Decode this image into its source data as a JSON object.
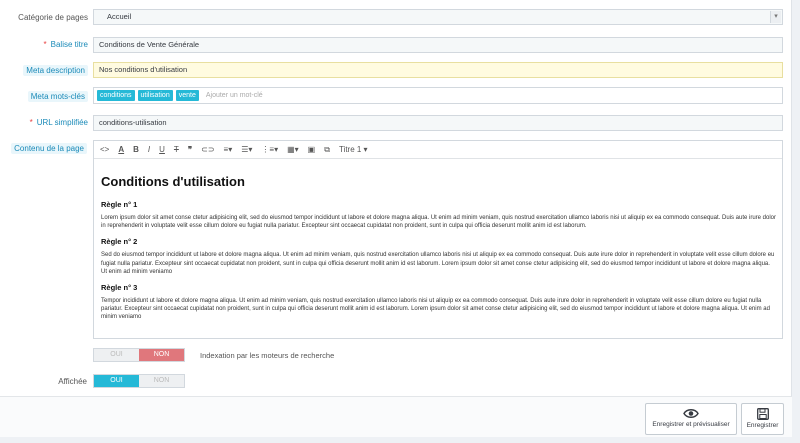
{
  "form": {
    "category": {
      "label": "Catégorie de pages",
      "value": "Accueil"
    },
    "meta_title": {
      "label": "Balise titre",
      "value": "Conditions de Vente Générale"
    },
    "meta_description": {
      "label": "Meta description",
      "value": "Nos conditions d'utilisation"
    },
    "meta_keywords": {
      "label": "Meta mots-clés",
      "tags": [
        "conditions",
        "utilisation",
        "vente"
      ],
      "placeholder": "Ajouter un mot-clé"
    },
    "friendly_url": {
      "label": "URL simplifiée",
      "value": "conditions-utilisation"
    },
    "content": {
      "label": "Contenu de la page"
    }
  },
  "editor": {
    "format_label": "Titre 1",
    "heading": "Conditions d'utilisation",
    "rules": [
      {
        "title": "Règle n° 1",
        "text": "Lorem ipsum dolor sit amet conse ctetur adipisicing elit, sed do eiusmod tempor incididunt ut labore et dolore magna aliqua. Ut enim ad minim veniam, quis nostrud exercitation ullamco laboris nisi ut aliquip ex ea commodo consequat. Duis aute irure dolor in reprehenderit in voluptate velit esse cillum dolore eu fugiat nulla pariatur. Excepteur sint occaecat cupidatat non proident, sunt in culpa qui officia deserunt mollit anim id est laborum."
      },
      {
        "title": "Règle n° 2",
        "text": "Sed do eiusmod tempor incididunt ut labore et dolore magna aliqua. Ut enim ad minim veniam, quis nostrud exercitation ullamco laboris nisi ut aliquip ex ea commodo consequat. Duis aute irure dolor in reprehenderit in voluptate velit esse cillum dolore eu fugiat nulla pariatur. Excepteur sint occaecat cupidatat non proident, sunt in culpa qui officia deserunt mollit anim id est laborum. Lorem ipsum dolor sit amet conse ctetur adipisicing elit, sed do eiusmod tempor incididunt ut labore et dolore magna aliqua. Ut enim ad minim veniamo"
      },
      {
        "title": "Règle n° 3",
        "text": "Tempor incididunt ut labore et dolore magna aliqua. Ut enim ad minim veniam, quis nostrud exercitation ullamco laboris nisi ut aliquip ex ea commodo consequat. Duis aute irure dolor in reprehenderit in voluptate velit esse cillum dolore eu fugiat nulla pariatur. Excepteur sint occaecat cupidatat non proident, sunt in culpa qui officia deserunt mollit anim id est laborum. Lorem ipsum dolor sit amet conse ctetur adipisicing elit, sed do eiusmod tempor incididunt ut labore et dolore magna aliqua. Ut enim ad minim veniamo"
      }
    ]
  },
  "indexation": {
    "yes": "OUI",
    "no": "NON",
    "selected": "NON",
    "text": "Indexation par les moteurs de recherche"
  },
  "displayed": {
    "label": "Affichée",
    "yes": "OUI",
    "no": "NON",
    "selected": "OUI"
  },
  "footer": {
    "save_preview": "Enregistrer et prévisualiser",
    "save": "Enregistrer"
  },
  "colors": {
    "accent": "#25b9d7",
    "danger": "#e0777c",
    "hint": "#1a8ab8"
  }
}
